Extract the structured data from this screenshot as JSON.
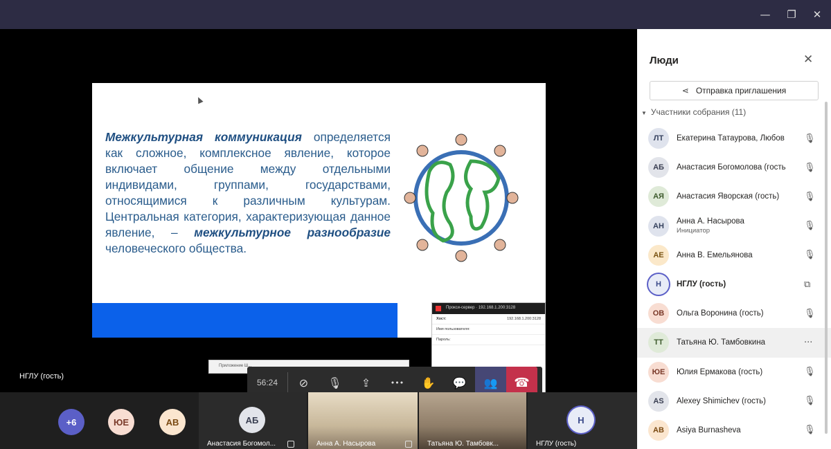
{
  "window": {
    "minimize": "—",
    "maximize": "❐",
    "close": "✕"
  },
  "slide": {
    "term1": "Межкультурная коммуникация",
    "body": " определяется как сложное, комплексное явление, которое включает общение между отдельными индивидами, группами, государствами, относящимися к различным культурам. Центральная категория, характеризующая данное явление, – ",
    "term2": "межкультурное разнообразие",
    "tail": " человеческого общества."
  },
  "proxy": {
    "title": "Прокси-сервер · 192.168.1.200:3128",
    "host_label": "Хост:",
    "host_value": "192.168.1.200:3128",
    "user_label": "Имя пользователя:",
    "pass_label": "Пароль:"
  },
  "strip_text": "Приложение Ш...",
  "controls": {
    "time": "56:24",
    "camera": "⊘",
    "mic": "🎙",
    "share": "⇪",
    "more": "•••",
    "hand": "✋",
    "chat": "💬",
    "people": "👥",
    "hangup": "☎"
  },
  "self_label": "НГЛУ (гость)",
  "gallery": {
    "overflow": "+6",
    "avatars": [
      {
        "initials": "ЮЕ",
        "bg": "#f8ddd2",
        "fg": "#7a3a2a"
      },
      {
        "initials": "АВ",
        "bg": "#fbe6cf",
        "fg": "#7a4a12"
      }
    ],
    "tiles": [
      {
        "initials": "АБ",
        "label": "Анастасия Богомол..."
      },
      {
        "label": "Анна А. Насырова"
      },
      {
        "label": "Татьяна Ю. Тамбовк..."
      },
      {
        "initials": "Н",
        "label": "НГЛУ (гость)"
      }
    ]
  },
  "panel": {
    "title": "Люди",
    "close": "✕",
    "invite_label": "Отправка приглашения",
    "section_label": "Участники собрания (11)",
    "participants": [
      {
        "initials": "ЛТ",
        "name": "Екатерина Татаурова, Любов",
        "role": "",
        "bg": "#dfe3ed",
        "fg": "#36425e",
        "bold": false,
        "icon": "mic-off"
      },
      {
        "initials": "АБ",
        "name": "Анастасия Богомолова (гость",
        "role": "",
        "bg": "#e2e4ea",
        "fg": "#3a3f52",
        "bold": false,
        "icon": "mic-off"
      },
      {
        "initials": "АЯ",
        "name": "Анастасия Яворская (гость)",
        "role": "",
        "bg": "#dfead8",
        "fg": "#3d5a2c",
        "bold": false,
        "icon": "mic-off"
      },
      {
        "initials": "АН",
        "name": "Анна А. Насырова",
        "role": "Инициатор",
        "bg": "#dfe3ed",
        "fg": "#36425e",
        "bold": false,
        "icon": "mic-off"
      },
      {
        "initials": "АЕ",
        "name": "Анна В. Емельянова",
        "role": "",
        "bg": "#fbe8c9",
        "fg": "#7a5312",
        "bold": false,
        "icon": "mic-off"
      },
      {
        "initials": "Н",
        "name": "НГЛУ (гость)",
        "role": "",
        "bg": "#e8ecf7",
        "fg": "#3b4a8a",
        "bold": true,
        "icon": "screen-share"
      },
      {
        "initials": "ОВ",
        "name": "Ольга Воронина (гость)",
        "role": "",
        "bg": "#f8ddd2",
        "fg": "#7a3a2a",
        "bold": false,
        "icon": "mic-off"
      },
      {
        "initials": "ТТ",
        "name": "Татьяна Ю. Тамбовкина",
        "role": "",
        "bg": "#dfead8",
        "fg": "#3d5a2c",
        "bold": false,
        "icon": "more"
      },
      {
        "initials": "ЮЕ",
        "name": "Юлия Ермакова (гость)",
        "role": "",
        "bg": "#f8ddd2",
        "fg": "#7a3a2a",
        "bold": false,
        "icon": "mic-off"
      },
      {
        "initials": "AS",
        "name": "Alexey Shimichev (гость)",
        "role": "",
        "bg": "#e2e4ea",
        "fg": "#3a3f52",
        "bold": false,
        "icon": "mic-off"
      },
      {
        "initials": "AB",
        "name": "Asiya Burnasheva",
        "role": "",
        "bg": "#fbe6cf",
        "fg": "#7a4a12",
        "bold": false,
        "icon": "mic-off"
      }
    ]
  }
}
